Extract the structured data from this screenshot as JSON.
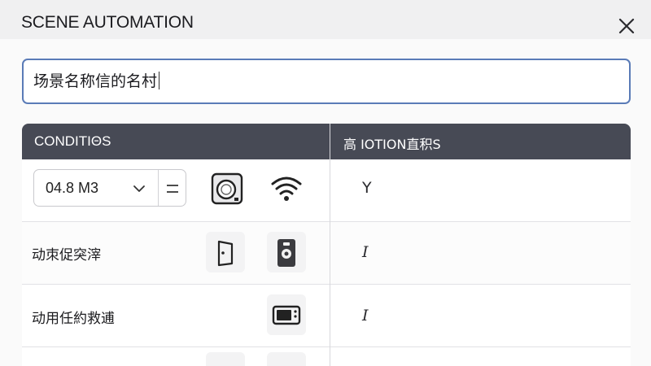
{
  "dialog": {
    "title": "SCENE AUTOMATION",
    "close_icon": "close-icon"
  },
  "scene_name": {
    "value": "场景名称信的名村"
  },
  "table": {
    "headers": {
      "conditions": "CONDITIΘS",
      "actions": "高 IOTION直积S"
    },
    "rows": [
      {
        "condition": {
          "select_value": "04.8 M3",
          "icons": [
            "chevron-down-icon",
            "menu-icon",
            "washing-machine-icon",
            "wifi-icon"
          ]
        },
        "action": "Y"
      },
      {
        "condition": {
          "label": "动朿促突滓",
          "icons": [
            "door-sensor-icon",
            "smart-lock-icon"
          ]
        },
        "action": "I"
      },
      {
        "condition": {
          "label": "动用任約救逋",
          "icons": [
            "microwave-icon"
          ]
        },
        "action": "I"
      }
    ]
  },
  "colors": {
    "header_bg": "#474a55",
    "input_border": "#5a7bb7",
    "panel_bg": "#fafafa"
  }
}
